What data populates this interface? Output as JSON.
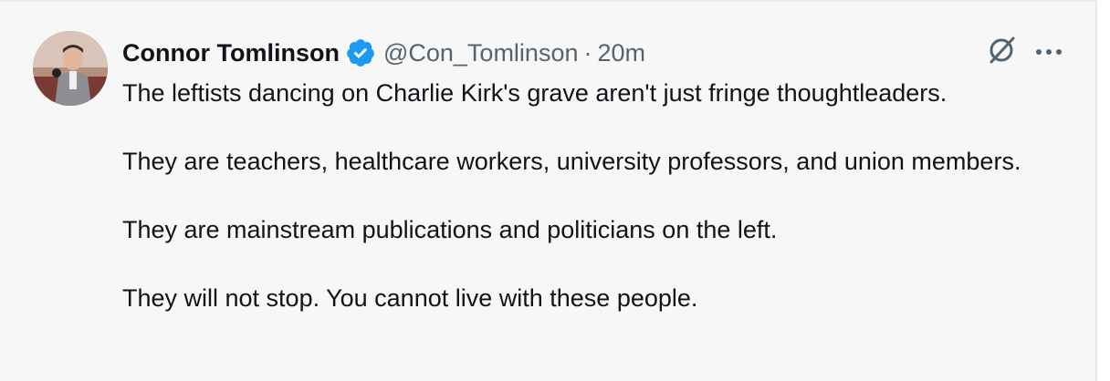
{
  "post": {
    "author_name": "Connor Tomlinson",
    "handle": "@Con_Tomlinson",
    "separator": "·",
    "time": "20m",
    "paragraphs": [
      "The leftists dancing on Charlie Kirk's grave aren't just fringe thoughtleaders.",
      "They are teachers, healthcare workers, university professors, and union members.",
      "They are mainstream publications and politicians on the left.",
      "They will not stop. You cannot live with these people."
    ]
  },
  "icons": {
    "verified": "verified-badge-icon",
    "grok": "grok-icon",
    "more": "more-options-icon"
  },
  "colors": {
    "verified_blue": "#1d9bf0",
    "text_primary": "#0f1419",
    "text_secondary": "#536471",
    "card_background": "#f7f7f7"
  }
}
